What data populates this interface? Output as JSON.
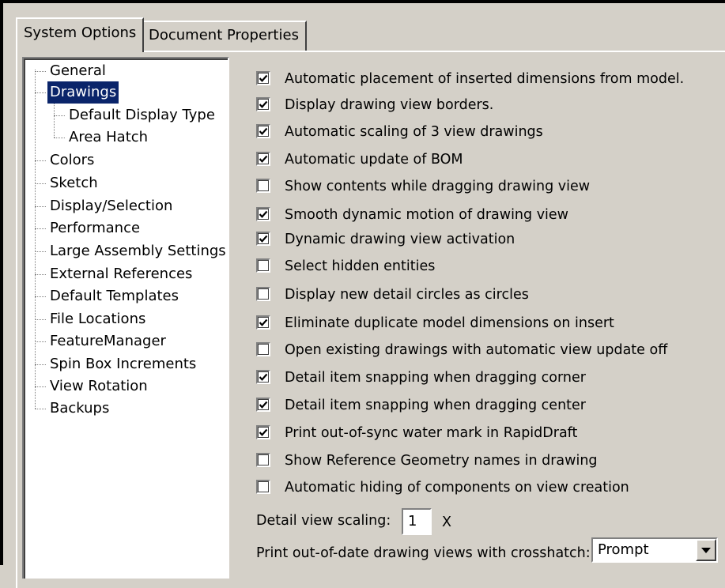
{
  "tabs": [
    {
      "label": "System Options",
      "active": true
    },
    {
      "label": "Document Properties",
      "active": false
    }
  ],
  "tree": {
    "items": [
      {
        "label": "General"
      },
      {
        "label": "Drawings",
        "selected": true
      },
      {
        "label": "Default Display Type"
      },
      {
        "label": "Area Hatch"
      },
      {
        "label": "Colors"
      },
      {
        "label": "Sketch"
      },
      {
        "label": "Display/Selection"
      },
      {
        "label": "Performance"
      },
      {
        "label": "Large Assembly Settings"
      },
      {
        "label": "External References"
      },
      {
        "label": "Default Templates"
      },
      {
        "label": "File Locations"
      },
      {
        "label": "FeatureManager"
      },
      {
        "label": "Spin Box Increments"
      },
      {
        "label": "View Rotation"
      },
      {
        "label": "Backups"
      }
    ]
  },
  "options": [
    {
      "label": "Automatic placement of inserted dimensions from model.",
      "checked": true
    },
    {
      "label": "Display drawing view borders.",
      "checked": true
    },
    {
      "label": "Automatic scaling of 3 view drawings",
      "checked": true
    },
    {
      "label": "Automatic update of BOM",
      "checked": true
    },
    {
      "label": "Show contents while dragging drawing view",
      "checked": false
    },
    {
      "label": "Smooth dynamic motion of drawing view",
      "checked": true
    },
    {
      "label": "Dynamic drawing view activation",
      "checked": true
    },
    {
      "label": "Select hidden entities",
      "checked": false
    },
    {
      "label": "Display new detail circles as circles",
      "checked": false
    },
    {
      "label": "Eliminate duplicate model dimensions on insert",
      "checked": true
    },
    {
      "label": "Open existing drawings with automatic view update off",
      "checked": false
    },
    {
      "label": "Detail item snapping when dragging corner",
      "checked": true
    },
    {
      "label": "Detail item snapping when dragging center",
      "checked": true
    },
    {
      "label": "Print out-of-sync water mark in RapidDraft",
      "checked": true
    },
    {
      "label": "Show Reference Geometry names in drawing",
      "checked": false
    },
    {
      "label": "Automatic hiding of components on view creation",
      "checked": false
    }
  ],
  "detail_view_scaling": {
    "label": "Detail view scaling:",
    "value": "1",
    "suffix": "X"
  },
  "crosshatch": {
    "label": "Print out-of-date drawing views with crosshatch:",
    "value": "Prompt"
  },
  "icons": {
    "checkmark": "check-icon",
    "dropdown": "chevron-down-icon"
  }
}
